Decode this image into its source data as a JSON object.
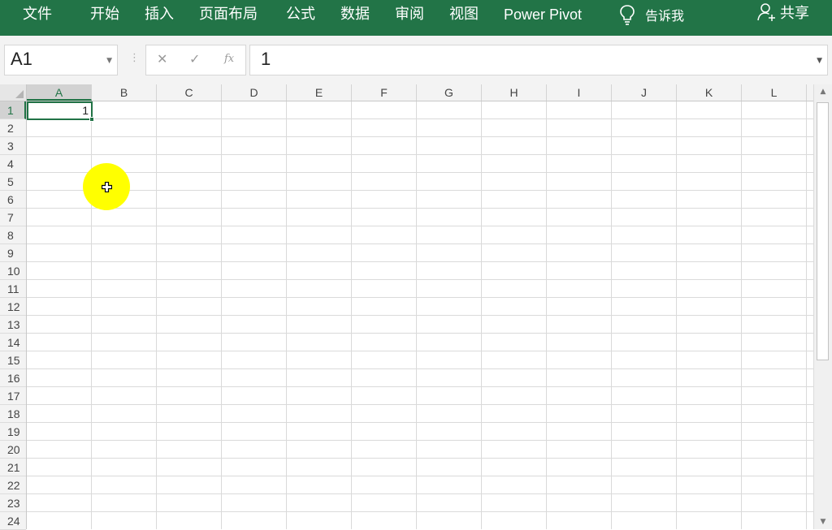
{
  "ribbon": {
    "tabs": [
      "文件",
      "开始",
      "插入",
      "页面布局",
      "公式",
      "数据",
      "审阅",
      "视图",
      "Power Pivot"
    ],
    "tell_me": "告诉我",
    "share": "共享",
    "bg_color": "#227447"
  },
  "formula_bar": {
    "name_box": "A1",
    "cancel_icon": "✕",
    "enter_icon": "✓",
    "fx_icon": "fx",
    "value": "1"
  },
  "sheet": {
    "columns": [
      "A",
      "B",
      "C",
      "D",
      "E",
      "F",
      "G",
      "H",
      "I",
      "J",
      "K",
      "L"
    ],
    "rows": [
      "1",
      "2",
      "3",
      "4",
      "5",
      "6",
      "7",
      "8",
      "9",
      "10",
      "11",
      "12",
      "13",
      "14",
      "15",
      "16",
      "17",
      "18",
      "19",
      "20",
      "21",
      "22",
      "23",
      "24"
    ],
    "selected_cell": "A1",
    "cells": {
      "A1": "1"
    },
    "accent": "#217346"
  },
  "cursor": {
    "type": "cell-cross-cursor",
    "highlight_color": "#ffff00"
  }
}
